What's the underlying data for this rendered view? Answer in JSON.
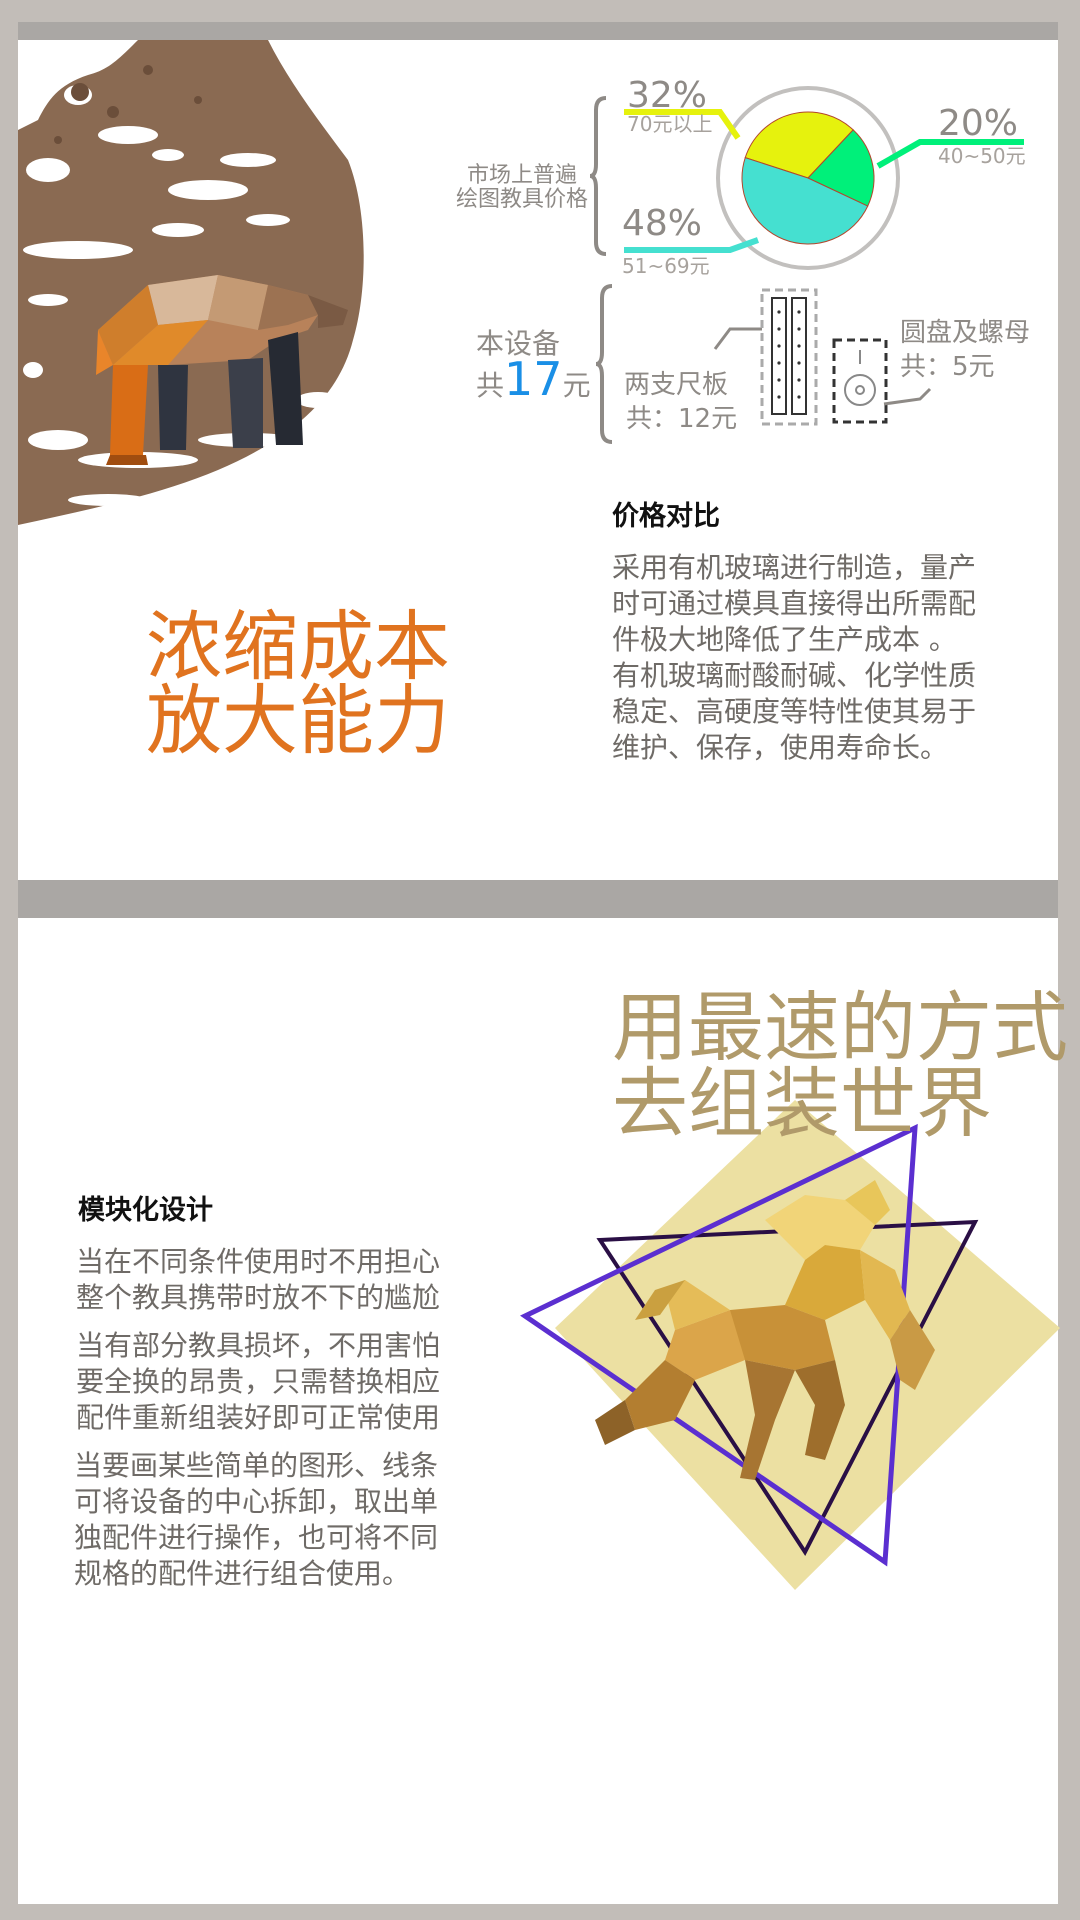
{
  "section1": {
    "market_label": [
      "市场上普遍",
      "绘图教具价格"
    ],
    "pie": [
      {
        "pct": "32%",
        "range": "70元以上",
        "color": "#e6f20d"
      },
      {
        "pct": "20%",
        "range": "40~50元",
        "color": "#00f07a"
      },
      {
        "pct": "48%",
        "range": "51~69元",
        "color": "#45e0d0"
      }
    ],
    "device_label": "本设备",
    "device_price_prefix": "共",
    "device_price": "17",
    "device_price_suffix": "元",
    "rulers_label": "两支尺板",
    "rulers_price": "共：12元",
    "disc_label": "圆盘及螺母",
    "disc_price": "共：5元",
    "heading": "价格对比",
    "paragraph": [
      "采用有机玻璃进行制造，量产",
      "时可通过模具直接得出所需配",
      "件极大地降低了生产成本 。",
      "有机玻璃耐酸耐碱、化学性质",
      "稳定、高硬度等特性使其易于",
      "维护、保存，使用寿命长。"
    ],
    "slogan": [
      "浓缩成本",
      "放大能力"
    ]
  },
  "section2": {
    "slogan": [
      "用最速的方式",
      "去组装世界"
    ],
    "heading": "模块化设计",
    "para1": [
      "当在不同条件使用时不用担心",
      "整个教具携带时放不下的尴尬"
    ],
    "para2": [
      "当有部分教具损坏，不用害怕",
      "要全换的昂贵，只需替换相应",
      "配件重新组装好即可正常使用"
    ],
    "para3": [
      "当要画某些简单的图形、线条",
      "可将设备的中心拆卸，取出单",
      "独配件进行操作，也可将不同",
      "规格的配件进行组合使用。"
    ]
  },
  "colors": {
    "accent_orange": "#e0731f",
    "accent_blue": "#1a8fe6",
    "accent_gold": "#b09a6a",
    "triangle_purple": "#5b2fd0",
    "triangle_dark": "#2a0f45"
  }
}
